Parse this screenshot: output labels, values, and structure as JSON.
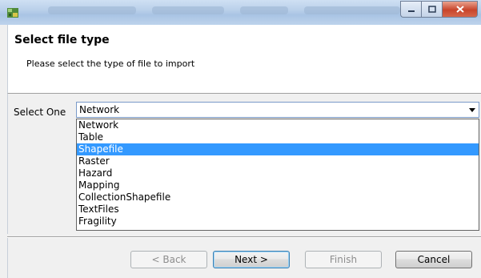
{
  "window": {
    "title": "",
    "controls": {
      "minimize": "–",
      "maximize": "□",
      "close": "x"
    }
  },
  "header": {
    "title": "Select file type",
    "subtitle": "Please select the type of file to import"
  },
  "selector": {
    "label": "Select One",
    "value": "Network",
    "options": [
      "Network",
      "Table",
      "Shapefile",
      "Raster",
      "Hazard",
      "Mapping",
      "CollectionShapefile",
      "TextFiles",
      "Fragility"
    ],
    "highlighted": "Shapefile"
  },
  "buttons": {
    "back": "< Back",
    "next": "Next >",
    "finish": "Finish",
    "cancel": "Cancel"
  }
}
